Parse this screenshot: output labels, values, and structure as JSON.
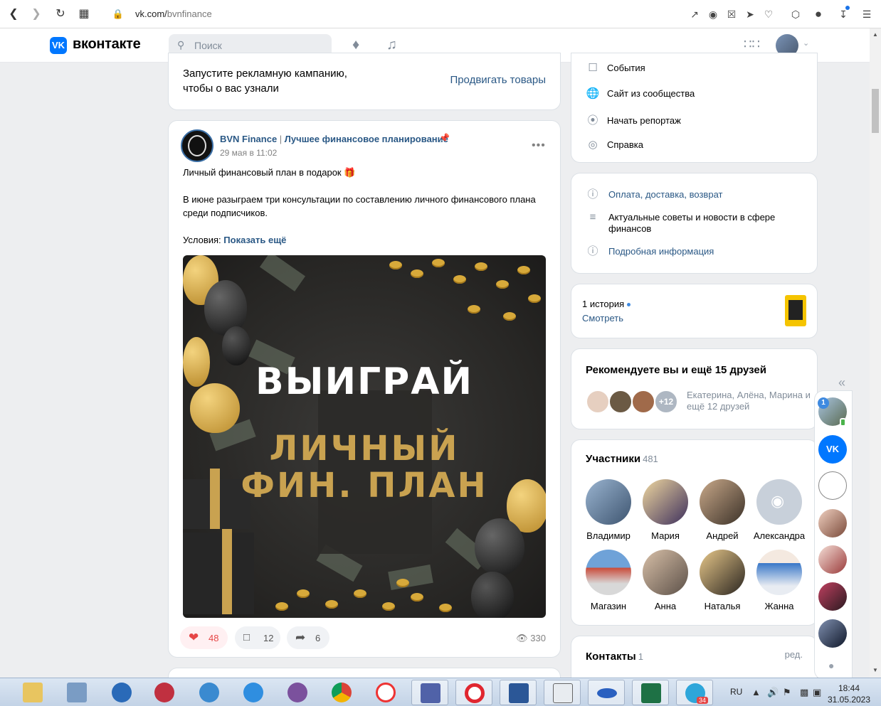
{
  "browser": {
    "url_domain": "vk.com/",
    "url_path": "bvnfinance",
    "nav_icons": [
      "back-arrow-icon",
      "forward-arrow-icon",
      "reload-icon",
      "tab-grid-icon",
      "lock-icon"
    ],
    "toolbar_icons": [
      "share-icon",
      "camera-icon",
      "shield-icon",
      "send-icon",
      "heart-icon",
      "cube-icon",
      "profile-icon",
      "download-icon",
      "menu-icon"
    ]
  },
  "header": {
    "logo_text": "вконтакте",
    "search_placeholder": "Поиск"
  },
  "promo": {
    "text": "Запустите рекламную кампанию, чтобы о вас узнали",
    "link": "Продвигать товары"
  },
  "post": {
    "author": "BVN Finance",
    "separator": " | ",
    "subtitle": "Лучшее финансовое планирование",
    "date": "29 мая в 11:02",
    "more": "•••",
    "line1": "Личный финансовый план в подарок 🎁",
    "line2": "В июне разыграем три консультации по составлению личного финансового плана среди подписчиков.",
    "conditions_label": "Условия:",
    "show_more": "Показать ещё",
    "image_title1": "ВЫИГРАЙ",
    "image_title2": "ЛИЧНЫЙ",
    "image_title3": "ФИН. ПЛАН",
    "likes": "48",
    "comments": "12",
    "shares": "6",
    "views": "330"
  },
  "menu": {
    "items": [
      {
        "label": "События",
        "icon": "checkbox-icon"
      },
      {
        "label": "Сайт из сообщества",
        "icon": "globe-icon"
      },
      {
        "label": "Начать репортаж",
        "icon": "broadcast-icon"
      },
      {
        "label": "Справка",
        "icon": "lifebuoy-icon"
      }
    ]
  },
  "info": {
    "items": [
      {
        "label": "Оплата, доставка, возврат",
        "icon": "question-icon"
      },
      {
        "label": "Актуальные советы и новости в сфере финансов",
        "icon": "lines-icon"
      },
      {
        "label": "Подробная информация",
        "icon": "info-icon"
      }
    ]
  },
  "stories": {
    "count": "1 история",
    "watch": "Смотреть"
  },
  "recommend": {
    "title": "Рекомендуете вы и ещё 15 друзей",
    "more_badge": "+12",
    "names": "Екатерина, Алёна, Марина и ещё 12 друзей"
  },
  "members": {
    "title": "Участники",
    "count": "481",
    "list": [
      {
        "name": "Владимир",
        "color": "#6f86a3"
      },
      {
        "name": "Мария",
        "color": "#3d2f5c"
      },
      {
        "name": "Андрей",
        "color": "#5b4a3e"
      },
      {
        "name": "Александра",
        "color": "#c8d0da"
      },
      {
        "name": "Магазин",
        "color": "#7ea7d4"
      },
      {
        "name": "Анна",
        "color": "#9a8b7d"
      },
      {
        "name": "Наталья",
        "color": "#b89a6a"
      },
      {
        "name": "Жанна",
        "color": "#d9e4f0"
      }
    ]
  },
  "contacts": {
    "title": "Контакты",
    "count": "1",
    "edit": "ред."
  },
  "chat": {
    "badge": "1"
  },
  "taskbar": {
    "lang": "RU",
    "time": "18:44",
    "date": "31.05.2023",
    "telegram_badge": "34"
  },
  "colors": {
    "vk_blue": "#0077ff",
    "link": "#2a5885",
    "like": "#e64646",
    "gold": "#c9a250"
  }
}
